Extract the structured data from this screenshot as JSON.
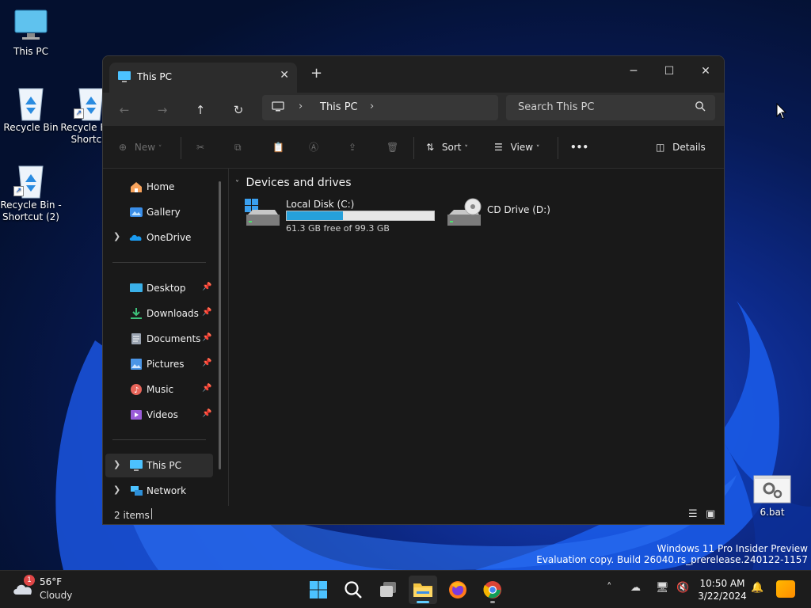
{
  "desktop": {
    "icons": [
      {
        "label": "This PC"
      },
      {
        "label": "Recycle Bin"
      },
      {
        "label": "Recycle Bin - Shortcut"
      },
      {
        "label": "Recycle Bin - Shortcut (2)"
      },
      {
        "label": "6.bat"
      }
    ]
  },
  "window": {
    "tab_title": "This PC",
    "new_tab_glyph": "+",
    "breadcrumb": [
      "This PC"
    ],
    "search_placeholder": "Search This PC",
    "commands": {
      "new": "New",
      "sort": "Sort",
      "view": "View",
      "more": "•••",
      "details": "Details"
    },
    "sidebar": {
      "top": [
        {
          "label": "Home",
          "icon": "home-icon"
        },
        {
          "label": "Gallery",
          "icon": "gallery-icon"
        },
        {
          "label": "OneDrive",
          "icon": "onedrive-icon"
        }
      ],
      "quick_access": [
        {
          "label": "Desktop",
          "icon": "desktop-folder-icon"
        },
        {
          "label": "Downloads",
          "icon": "downloads-icon"
        },
        {
          "label": "Documents",
          "icon": "documents-icon"
        },
        {
          "label": "Pictures",
          "icon": "pictures-icon"
        },
        {
          "label": "Music",
          "icon": "music-icon"
        },
        {
          "label": "Videos",
          "icon": "videos-icon"
        }
      ],
      "locations": [
        {
          "label": "This PC",
          "icon": "this-pc-icon",
          "selected": true
        },
        {
          "label": "Network",
          "icon": "network-icon"
        }
      ]
    },
    "content": {
      "group_title": "Devices and drives",
      "drives": [
        {
          "name": "Local Disk (C:)",
          "free_text": "61.3 GB free of 99.3 GB",
          "used_fraction": 0.383
        },
        {
          "name": "CD Drive (D:)"
        }
      ]
    },
    "status": {
      "item_count": "2 items"
    }
  },
  "watermark": {
    "line1": "Windows 11 Pro Insider Preview",
    "line2": "Evaluation copy. Build 26040.rs_prerelease.240122-1157"
  },
  "taskbar": {
    "weather": {
      "temp": "56°F",
      "condition": "Cloudy",
      "badge": "1"
    },
    "clock": {
      "time": "10:50 AM",
      "date": "3/22/2024"
    }
  },
  "colors": {
    "accent": "#26a0da",
    "window_bg": "#191919",
    "taskbar_bg": "#1c1c1c"
  }
}
